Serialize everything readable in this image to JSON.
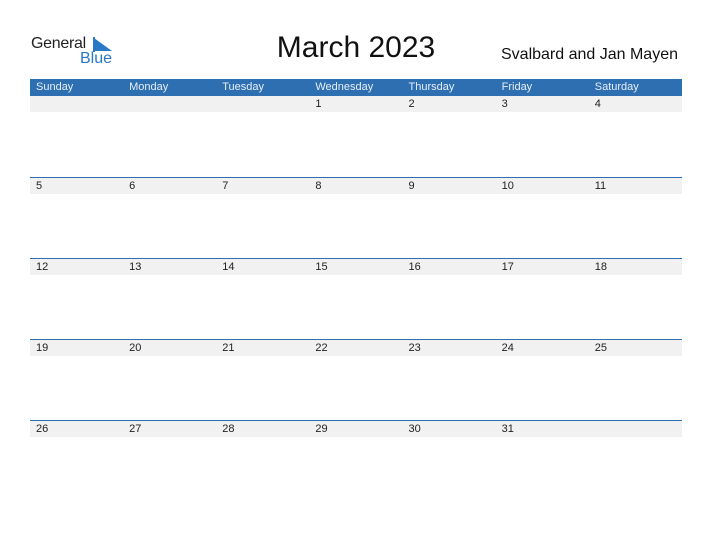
{
  "logo": {
    "general": "General",
    "blue": "Blue"
  },
  "title": "March 2023",
  "region": "Svalbard and Jan Mayen",
  "weekdays": [
    "Sunday",
    "Monday",
    "Tuesday",
    "Wednesday",
    "Thursday",
    "Friday",
    "Saturday"
  ],
  "weeks": [
    [
      "",
      "",
      "",
      "1",
      "2",
      "3",
      "4"
    ],
    [
      "5",
      "6",
      "7",
      "8",
      "9",
      "10",
      "11"
    ],
    [
      "12",
      "13",
      "14",
      "15",
      "16",
      "17",
      "18"
    ],
    [
      "19",
      "20",
      "21",
      "22",
      "23",
      "24",
      "25"
    ],
    [
      "26",
      "27",
      "28",
      "29",
      "30",
      "31",
      ""
    ]
  ],
  "colors": {
    "accent": "#2e6fb1",
    "strip": "#f1f1f1"
  }
}
